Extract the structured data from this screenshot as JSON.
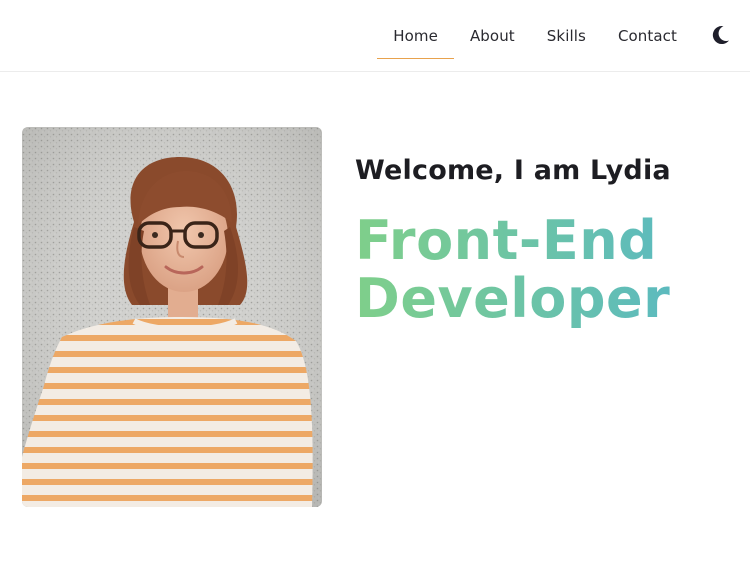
{
  "nav": {
    "items": [
      {
        "label": "Home",
        "active": true
      },
      {
        "label": "About",
        "active": false
      },
      {
        "label": "Skills",
        "active": false
      },
      {
        "label": "Contact",
        "active": false
      }
    ],
    "theme_toggle_icon": "moon-icon",
    "active_underline_color": "#e8a24d"
  },
  "hero": {
    "welcome": "Welcome, I am Lydia",
    "role_line1": "Front-End",
    "role_line2": "Developer",
    "role_gradient": [
      "#7fcf8a",
      "#55b6c9"
    ],
    "portrait_icon": "profile-photo"
  }
}
